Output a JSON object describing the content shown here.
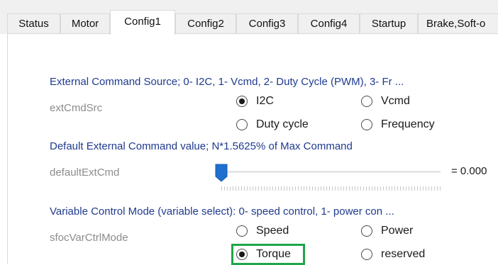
{
  "tabs": [
    {
      "label": "Status"
    },
    {
      "label": "Motor"
    },
    {
      "label": "Config1"
    },
    {
      "label": "Config2"
    },
    {
      "label": "Config3"
    },
    {
      "label": "Config4"
    },
    {
      "label": "Startup"
    },
    {
      "label": "Brake,Soft-o"
    }
  ],
  "active_tab": "Config1",
  "ext_cmd_src": {
    "description": "External Command Source; 0- I2C, 1- Vcmd, 2- Duty Cycle (PWM), 3- Fr ...",
    "param_name": "extCmdSrc",
    "options": [
      "I2C",
      "Vcmd",
      "Duty cycle",
      "Frequency"
    ],
    "selected": "I2C"
  },
  "default_ext_cmd": {
    "description": "Default External Command value; N*1.5625% of Max Command",
    "param_name": "defaultExtCmd",
    "value_label": "= 0.000",
    "slider_fraction": 0.0,
    "thumb_color": "#1f6fd1"
  },
  "var_ctrl_mode": {
    "description": "Variable Control Mode (variable select): 0- speed control, 1- power con ...",
    "param_name": "sfocVarCtrlMode",
    "options": [
      "Speed",
      "Power",
      "Torque",
      "reserved"
    ],
    "selected": "Torque",
    "highlight_color": "#1fa64a"
  }
}
